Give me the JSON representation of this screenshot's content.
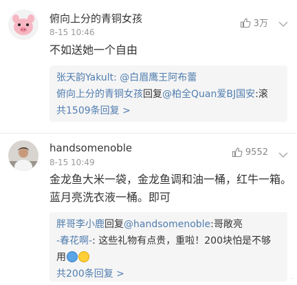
{
  "comments": [
    {
      "username": "俯向上分的青铜女孩",
      "time": "8-15 10:46",
      "likes": "3万",
      "text": "不如送她一个自由",
      "replies": [
        {
          "author": "张天韵Yakult:",
          "content": " @白眉鹰王阿布蕾"
        },
        {
          "author": "俯向上分的青铜女孩",
          "verb": "回复",
          "target": "@柏全Quan爱BJ国安",
          "content": ":滚"
        }
      ],
      "reply_summary": "共1509条回复 >"
    },
    {
      "username": "handsomenoble",
      "time": "8-15 10:49",
      "likes": "9552",
      "text_lines": [
        "金龙鱼大米一袋，金龙鱼调和油一桶，红牛一箱。",
        "蓝月亮洗衣液一桶。即可"
      ],
      "replies": [
        {
          "author": "胖哥李小鹿",
          "verb": "回复",
          "target": "@handsomenoble",
          "content": ":哥敞亮"
        },
        {
          "author": "-春花啊-",
          "content": ": 这些礼物有点贵，重啦！200块怕是不够"
        },
        {
          "content": "用"
        }
      ],
      "reply_summary": "共200条回复 >"
    }
  ],
  "icons": {
    "like": "thumbs-up-icon",
    "more": "chevron-down-icon"
  },
  "colors": {
    "link": "#507daf",
    "reply_bg": "#f5f5f5",
    "muted": "#999999"
  }
}
